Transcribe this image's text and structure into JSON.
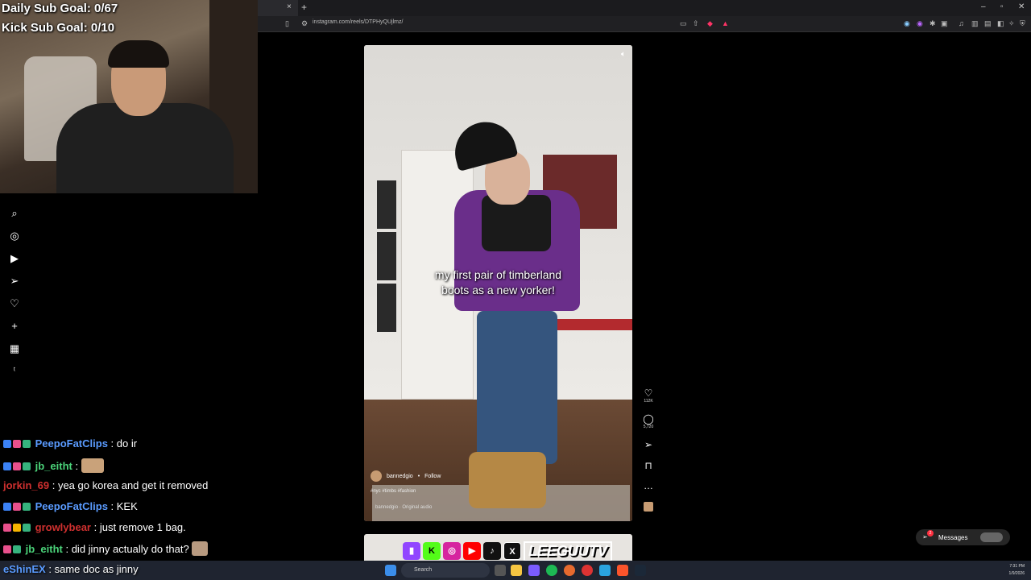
{
  "overlay": {
    "daily_goal": "Daily Sub Goal: 0/67",
    "kick_goal": "Kick Sub Goal: 0/10"
  },
  "browser": {
    "url": "instagram.com/reels/DTPHyQUjlmz/",
    "tab_close": "×",
    "tab_new": "+"
  },
  "reel": {
    "caption_line1": "my first pair of timberland",
    "caption_line2": "boots as a new yorker!",
    "author": "bannedgio",
    "follow": "Follow",
    "tags": "#nyc #timbs #fashion",
    "audio": "bannedgio · Original audio",
    "likes": "112K",
    "comments": "5,720"
  },
  "messages": {
    "label": "Messages",
    "badge": "2"
  },
  "chat": [
    {
      "user": "PeepoFatClips",
      "color": "#5a9bff",
      "text": "do ir"
    },
    {
      "user": "jb_eitht",
      "color": "#4bd47a",
      "text": ""
    },
    {
      "user": "jorkin_69",
      "color": "#d0302f",
      "text": "yea go korea and get it removed"
    },
    {
      "user": "PeepoFatClips",
      "color": "#5a9bff",
      "text": "KEK"
    },
    {
      "user": "growlybear",
      "color": "#d0302f",
      "text": "just remove 1 bag."
    },
    {
      "user": "jb_eitht",
      "color": "#4bd47a",
      "text": "did jinny actually do that?"
    },
    {
      "user": "eShinEX",
      "color": "#5a9bff",
      "text": "same doc as jinny"
    }
  ],
  "brand": {
    "name": "LEEGUUTV"
  },
  "taskbar": {
    "search": "Search",
    "time": "7:31 PM",
    "date": "1/9/2026"
  },
  "colors": {
    "accent": "#ff3040",
    "chat_bg": "#000000"
  }
}
